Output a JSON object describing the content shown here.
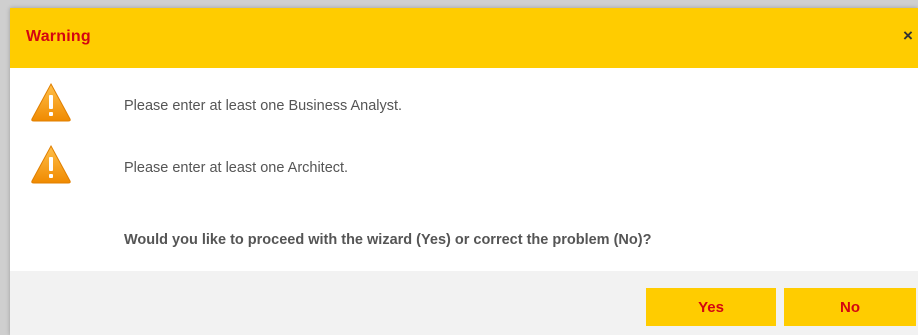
{
  "dialog": {
    "title": "Warning",
    "close_symbol": "×",
    "close_icon": "close-icon"
  },
  "messages": [
    {
      "icon": "warning-icon",
      "text": "Please enter at least one Business Analyst."
    },
    {
      "icon": "warning-icon",
      "text": "Please enter at least one Architect."
    }
  ],
  "question": "Would you like to proceed with the wizard (Yes) or correct the problem (No)?",
  "buttons": {
    "yes_label": "Yes",
    "no_label": "No"
  },
  "colors": {
    "accent_yellow": "#ffcc00",
    "accent_red": "#d40511",
    "warning_orange": "#f5a623",
    "text_gray": "#555555",
    "footer_gray": "#f2f2f2"
  }
}
